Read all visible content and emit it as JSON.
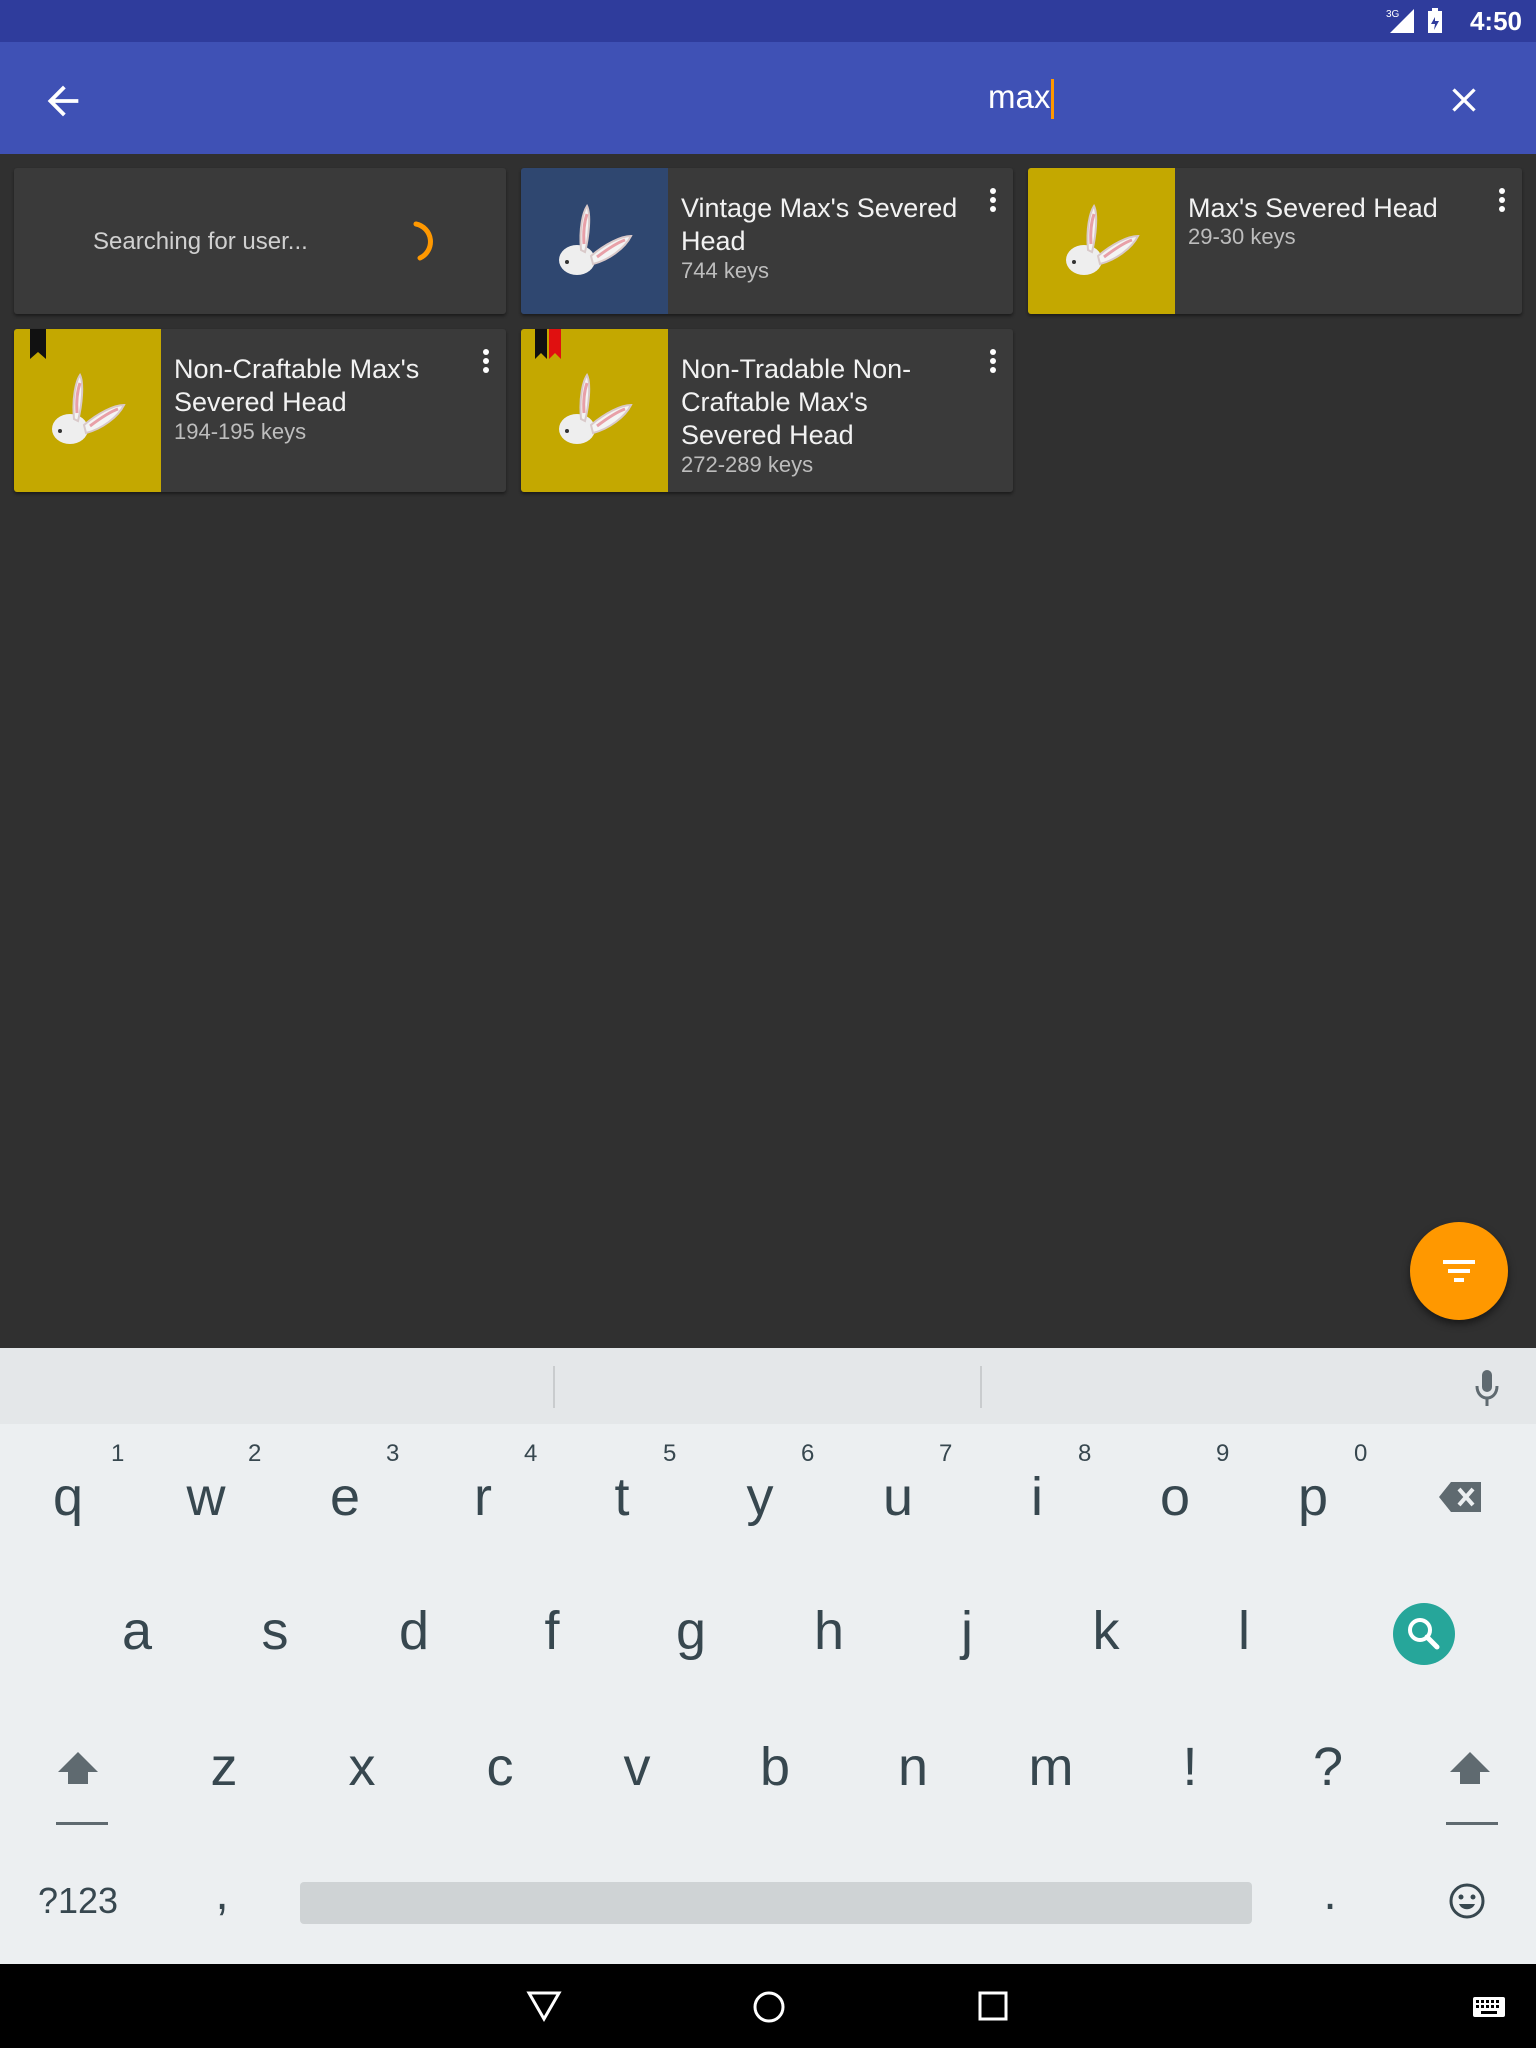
{
  "status_bar": {
    "time": "4:50",
    "network": "3G"
  },
  "toolbar": {
    "search_query": "max"
  },
  "user_search": {
    "label": "Searching for user..."
  },
  "results": [
    {
      "title": "Vintage Max's Severed Head",
      "price": "744 keys",
      "thumb_color": "#2f4770",
      "ribbon": "none"
    },
    {
      "title": "Max's Severed Head",
      "price": "29-30 keys",
      "thumb_color": "#c4a800",
      "ribbon": "none"
    },
    {
      "title": "Non-Craftable Max's Severed Head",
      "price": "194-195 keys",
      "thumb_color": "#c4a800",
      "ribbon": "black"
    },
    {
      "title": "Non-Tradable Non-Craftable Max's Severed Head",
      "price": "272-289 keys",
      "thumb_color": "#c4a800",
      "ribbon": "black-red"
    }
  ],
  "fab": {
    "icon": "filter-icon",
    "color": "#ff9800"
  },
  "keyboard": {
    "row1": [
      "q",
      "w",
      "e",
      "r",
      "t",
      "y",
      "u",
      "i",
      "o",
      "p"
    ],
    "row1_hints": [
      "1",
      "2",
      "3",
      "4",
      "5",
      "6",
      "7",
      "8",
      "9",
      "0"
    ],
    "row2": [
      "a",
      "s",
      "d",
      "f",
      "g",
      "h",
      "j",
      "k",
      "l"
    ],
    "row3": [
      "z",
      "x",
      "c",
      "v",
      "b",
      "n",
      "m",
      "!",
      "?"
    ],
    "symbols_label": "?123",
    "comma": ",",
    "period": "."
  }
}
